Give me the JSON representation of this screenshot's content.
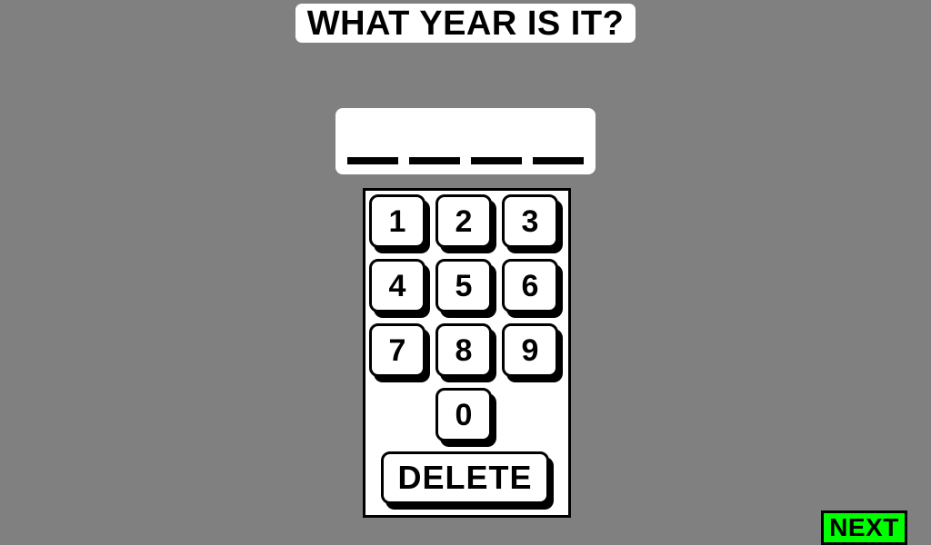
{
  "prompt": {
    "question": "WHAT YEAR IS IT?"
  },
  "answer": {
    "slots": [
      "",
      "",
      "",
      ""
    ]
  },
  "keypad": {
    "keys": {
      "k1": "1",
      "k2": "2",
      "k3": "3",
      "k4": "4",
      "k5": "5",
      "k6": "6",
      "k7": "7",
      "k8": "8",
      "k9": "9",
      "k0": "0"
    },
    "delete_label": "DELETE"
  },
  "next": {
    "label": "NEXT"
  },
  "colors": {
    "background": "#808080",
    "panel": "#ffffff",
    "ink": "#000000",
    "next_button": "#00ff00"
  }
}
